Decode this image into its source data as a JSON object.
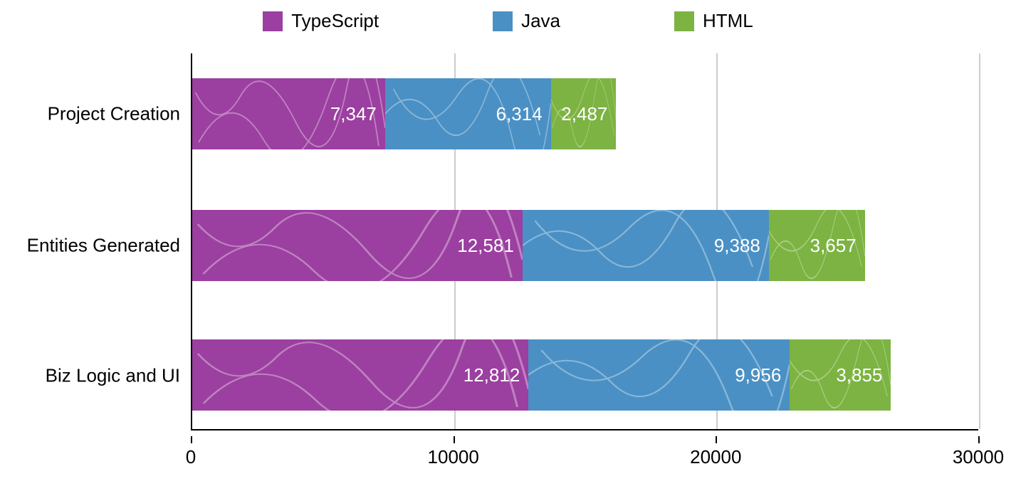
{
  "chart_data": {
    "type": "bar",
    "orientation": "horizontal",
    "stacked": true,
    "categories": [
      "Project Creation",
      "Entities Generated",
      "Biz Logic and UI"
    ],
    "series": [
      {
        "name": "TypeScript",
        "values": [
          7347,
          12581,
          12812
        ],
        "color": "#9B3FA0"
      },
      {
        "name": "Java",
        "values": [
          6314,
          9388,
          9956
        ],
        "color": "#4A90C4"
      },
      {
        "name": "HTML",
        "values": [
          2487,
          3657,
          3855
        ],
        "color": "#7CB342"
      }
    ],
    "x_ticks": [
      0,
      10000,
      20000,
      30000
    ],
    "xlim": [
      0,
      30000
    ],
    "xlabel": "",
    "ylabel": "",
    "title": "",
    "legend_position": "top",
    "data_labels": {
      "Project Creation": [
        "7,347",
        "6,314",
        "2,487"
      ],
      "Entities Generated": [
        "12,581",
        "9,388",
        "3,657"
      ],
      "Biz Logic and UI": [
        "12,812",
        "9,956",
        "3,855"
      ]
    }
  },
  "colors": {
    "typescript": "#9B3FA0",
    "java": "#4A90C4",
    "html": "#7CB342",
    "axis": "#000000",
    "grid": "#cccccc"
  }
}
